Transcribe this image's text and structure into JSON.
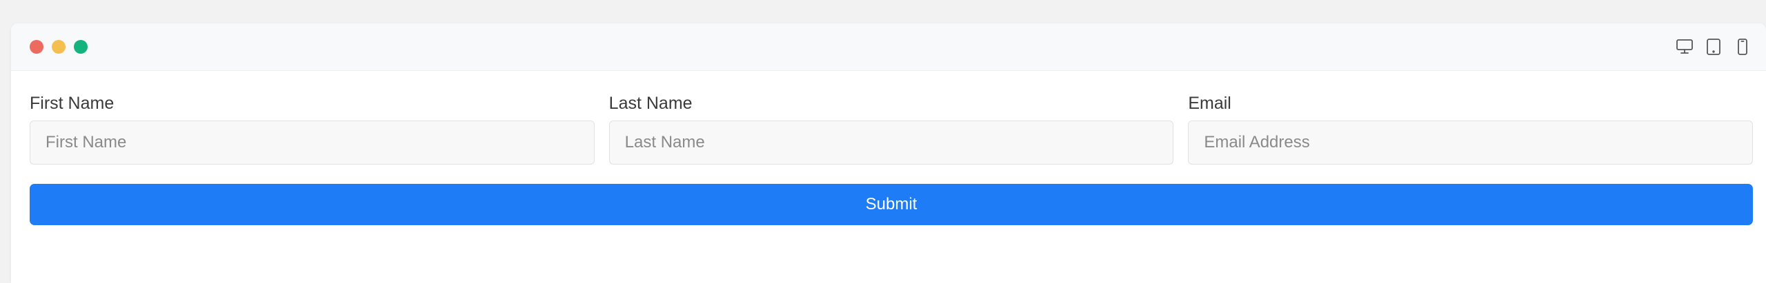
{
  "window": {
    "traffic_lights": [
      {
        "name": "close",
        "color": "#ed6a5e"
      },
      {
        "name": "minimize",
        "color": "#f5bf4f"
      },
      {
        "name": "maximize",
        "color": "#14b37d"
      }
    ],
    "device_icons": [
      "desktop-icon",
      "tablet-icon",
      "mobile-icon"
    ]
  },
  "form": {
    "fields": [
      {
        "label": "First Name",
        "placeholder": "First Name",
        "value": ""
      },
      {
        "label": "Last Name",
        "placeholder": "Last Name",
        "value": ""
      },
      {
        "label": "Email",
        "placeholder": "Email Address",
        "value": ""
      }
    ],
    "submit_label": "Submit"
  },
  "colors": {
    "accent": "#1e7cf7",
    "background": "#f2f2f2",
    "titlebar": "#f8f9fa"
  }
}
